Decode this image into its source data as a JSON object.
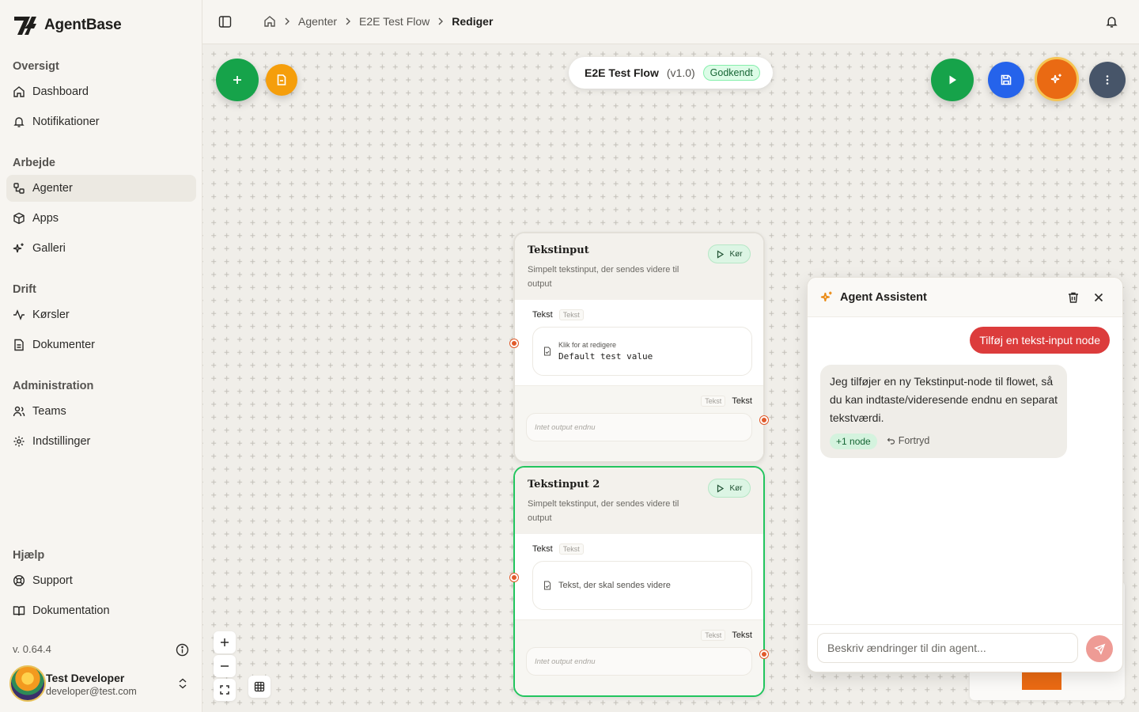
{
  "brand": {
    "name": "AgentBase"
  },
  "sidebar": {
    "sections": [
      {
        "heading": "Oversigt",
        "items": [
          {
            "label": "Dashboard",
            "icon": "home-icon"
          },
          {
            "label": "Notifikationer",
            "icon": "bell-icon"
          }
        ]
      },
      {
        "heading": "Arbejde",
        "items": [
          {
            "label": "Agenter",
            "icon": "workflow-icon",
            "active": true
          },
          {
            "label": "Apps",
            "icon": "box-icon"
          },
          {
            "label": "Galleri",
            "icon": "sparkles-icon"
          }
        ]
      },
      {
        "heading": "Drift",
        "items": [
          {
            "label": "Kørsler",
            "icon": "activity-icon"
          },
          {
            "label": "Dokumenter",
            "icon": "document-icon"
          }
        ]
      },
      {
        "heading": "Administration",
        "items": [
          {
            "label": "Teams",
            "icon": "users-icon"
          },
          {
            "label": "Indstillinger",
            "icon": "gear-icon"
          }
        ]
      },
      {
        "heading": "Hjælp",
        "items": [
          {
            "label": "Support",
            "icon": "lifebuoy-icon"
          },
          {
            "label": "Dokumentation",
            "icon": "book-icon"
          }
        ]
      }
    ],
    "version": "v. 0.64.4",
    "user": {
      "name": "Test Developer",
      "email": "developer@test.com"
    }
  },
  "breadcrumb": {
    "items": [
      "Agenter",
      "E2E Test Flow"
    ],
    "current": "Rediger"
  },
  "flow": {
    "name": "E2E Test Flow",
    "version": "(v1.0)",
    "status": "Godkendt"
  },
  "nodes": [
    {
      "title": "Tekstinput",
      "description": "Simpelt tekstinput, der sendes videre til output",
      "run_label": "Kør",
      "input_label": "Tekst",
      "input_type": "Tekst",
      "edit_hint": "Klik for at redigere",
      "input_value": "Default test value",
      "output_type": "Tekst",
      "output_label": "Tekst",
      "output_placeholder": "Intet output endnu"
    },
    {
      "title": "Tekstinput 2",
      "description": "Simpelt tekstinput, der sendes videre til output",
      "run_label": "Kør",
      "input_label": "Tekst",
      "input_type": "Tekst",
      "input_placeholder": "Tekst, der skal sendes videre",
      "output_type": "Tekst",
      "output_label": "Tekst",
      "output_placeholder": "Intet output endnu"
    }
  ],
  "assistant": {
    "title": "Agent Assistent",
    "user_message": "Tilføj en tekst-input node",
    "bot_message": "Jeg tilføjer en ny Tekstinput-node til flowet, så du kan indtaste/videresende endnu en separat tekstværdi.",
    "node_chip": "+1 node",
    "undo_label": "Fortryd",
    "input_placeholder": "Beskriv ændringer til din agent..."
  },
  "colors": {
    "add_button": "#16a34a",
    "file_button": "#f59e0b",
    "run_button": "#16a34a",
    "save_button": "#2563eb",
    "ai_button": "#ea6a13",
    "more_button": "#475569",
    "user_bubble": "#dc3c3c"
  }
}
